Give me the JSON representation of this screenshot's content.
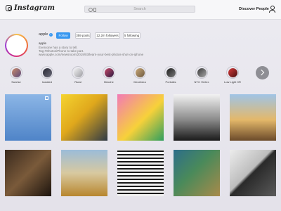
{
  "header": {
    "brand": "Instagram",
    "search": {
      "placeholder": "Search"
    },
    "discover_label": "Discover People"
  },
  "profile": {
    "username": "apple",
    "verified": true,
    "follow_label": "Follow",
    "posts_label": "359 posts",
    "followers_label": "12.2m followers",
    "following_label": "5 following",
    "display_name": "apple",
    "bio": [
      "Everyone has a story to tell.",
      "Tag #ShotoniPhone to take part.",
      "www.apple.com/newsroom/2019/03/learn-your-best-photos-shot-on-iphone"
    ]
  },
  "highlights": [
    {
      "label": "Sunrise",
      "color_a": "#c98a6b",
      "color_b": "#5a4a7a"
    },
    {
      "label": "Isolated",
      "color_a": "#2a2a35",
      "color_b": "#6a6a78"
    },
    {
      "label": "Rural",
      "color_a": "#f2f2f2",
      "color_b": "#9a9aa0"
    },
    {
      "label": "Brioche",
      "color_a": "#c94a6a",
      "color_b": "#2a1a40"
    },
    {
      "label": "Decebera",
      "color_a": "#caa878",
      "color_b": "#6d5a40"
    },
    {
      "label": "Portraits",
      "color_a": "#1f1f1f",
      "color_b": "#7a7a7a"
    },
    {
      "label": "NYC Vertex",
      "color_a": "#3a3a3a",
      "color_b": "#a8a8a8"
    },
    {
      "label": "Low Light XR",
      "color_a": "#d63a3a",
      "color_b": "#4a1010"
    }
  ],
  "posts": [
    {
      "name": "post-birds-sky",
      "bg": "linear-gradient(180deg,#8cb6e6 0%,#4f84c8 100%)"
    },
    {
      "name": "post-yellow-glass",
      "bg": "linear-gradient(135deg,#f5d430 0%,#e0a81c 45%,#2f3a46 100%)"
    },
    {
      "name": "post-pink-star",
      "bg": "linear-gradient(135deg,#f27ab6 0%,#f7d13a 55%,#2f9f5e 100%)"
    },
    {
      "name": "post-bw-building",
      "bg": "linear-gradient(180deg,#f2f2f2 0%,#8a8a8a 55%,#1a1a1a 100%)"
    },
    {
      "name": "post-sunset-rocks",
      "bg": "linear-gradient(180deg,#9fc4e6 0%,#e4b86a 55%,#6b4a2a 100%)"
    },
    {
      "name": "post-shadow-wall",
      "bg": "linear-gradient(135deg,#3a2a1e 0%,#7a5a3a 50%,#1c140e 100%)"
    },
    {
      "name": "post-vintage-car",
      "bg": "linear-gradient(180deg,#9bbcd9 0%,#d8c9a0 50%,#b8862e 100%)"
    },
    {
      "name": "post-bw-stripes",
      "bg": "repeating-linear-gradient(0deg,#f0f0f0 0px,#f0f0f0 3px,#1a1a1a 3px,#1a1a1a 5px)"
    },
    {
      "name": "post-coast-aerial",
      "bg": "linear-gradient(135deg,#2d6e8a 0%,#4a8a5a 45%,#a88a4a 100%)"
    },
    {
      "name": "post-bw-diagonal",
      "bg": "linear-gradient(135deg,#ececec 0%,#bdbdbd 45%,#2a2a2a 50%,#5a5a5a 100%)"
    }
  ]
}
